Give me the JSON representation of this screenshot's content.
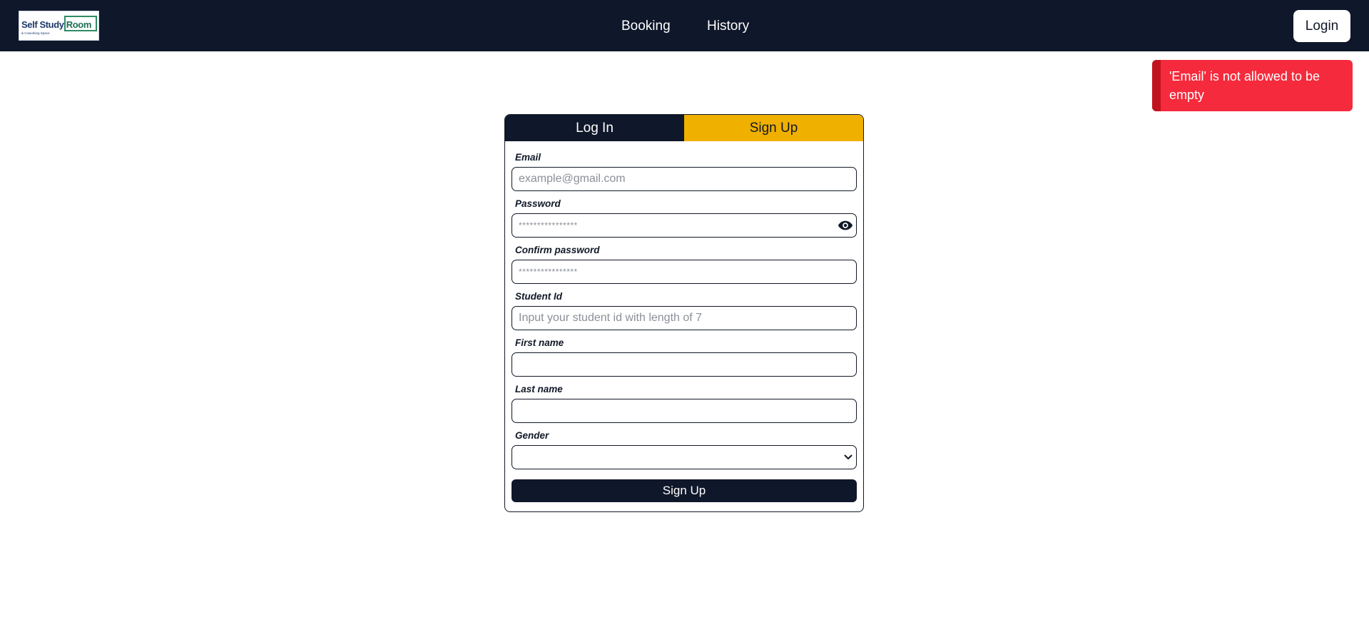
{
  "header": {
    "logo": {
      "title_part1": "Self Study ",
      "title_part2": "Room",
      "subtitle": "& Coworking Space"
    },
    "nav": {
      "booking": "Booking",
      "history": "History"
    },
    "login_label": "Login"
  },
  "toast": {
    "message": "'Email' is not allowed to be empty"
  },
  "form": {
    "tabs": {
      "login": "Log In",
      "signup": "Sign Up"
    },
    "active_tab": "Sign Up",
    "fields": {
      "email": {
        "label": "Email",
        "placeholder": "example@gmail.com",
        "value": ""
      },
      "password": {
        "label": "Password",
        "placeholder": "****************",
        "value": ""
      },
      "confirm_password": {
        "label": "Confirm password",
        "placeholder": "****************",
        "value": ""
      },
      "student_id": {
        "label": "Student Id",
        "placeholder": "Input your student id with length of 7",
        "value": ""
      },
      "first_name": {
        "label": "First name",
        "placeholder": "",
        "value": ""
      },
      "last_name": {
        "label": "Last name",
        "placeholder": "",
        "value": ""
      },
      "gender": {
        "label": "Gender",
        "value": ""
      }
    },
    "submit_label": "Sign Up"
  },
  "icons": {
    "password_toggle": "eye-icon",
    "gender_dropdown": "chevron-down-icon"
  },
  "colors": {
    "navbar": "#0f172a",
    "active_tab": "#f0b000",
    "toast": "#f52a3c",
    "toast_accent": "#c1121f",
    "button": "#0f172a"
  }
}
